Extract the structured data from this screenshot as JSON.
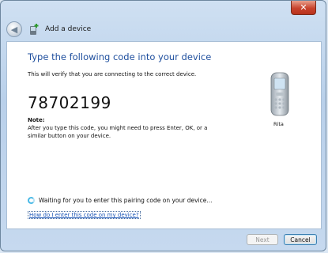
{
  "window": {
    "title": "Add a device",
    "close_glyph": "✕",
    "back_glyph": "◀"
  },
  "main": {
    "heading": "Type the following code into your device",
    "subtext": "This will verify that you are connecting to the correct device.",
    "pairing_code": "78702199",
    "note_label": "Note:",
    "note_text": "After you type this code, you might need to press Enter, OK, or a similar button on your device.",
    "device_name": "Rita",
    "waiting_text": "Waiting for you to enter this pairing code on your device...",
    "help_link": "How do I enter this code on my device?"
  },
  "footer": {
    "next_label": "Next",
    "cancel_label": "Cancel"
  },
  "colors": {
    "heading": "#1f4f9e",
    "link": "#1a55b7",
    "close_button": "#c8432d"
  },
  "icons": {
    "titlebar": "add-device-icon",
    "device": "mobile-phone-icon",
    "status": "busy-spinner-icon"
  }
}
